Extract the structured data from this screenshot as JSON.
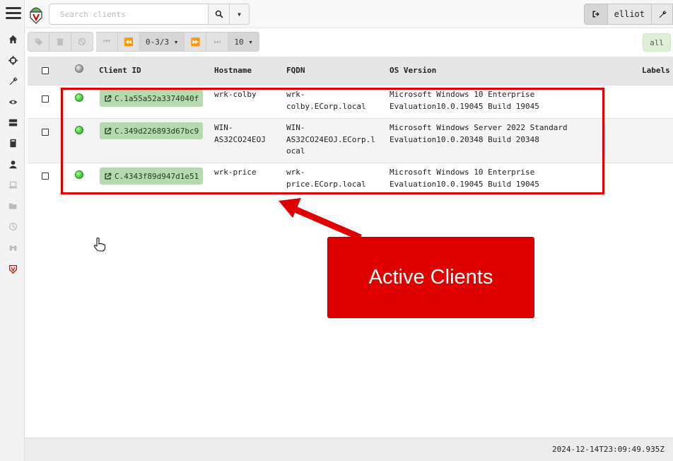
{
  "topbar": {
    "search_placeholder": "Search clients",
    "user": "elliot"
  },
  "toolbar": {
    "pager": "0-3/3",
    "page_size": "10",
    "filter": "all"
  },
  "table": {
    "columns": [
      "Client ID",
      "Hostname",
      "FQDN",
      "OS Version",
      "Labels"
    ],
    "rows": [
      {
        "client_id": "C.1a55a52a3374040f",
        "hostname": [
          "wrk-colby"
        ],
        "fqdn": [
          "wrk-",
          "colby.ECorp.local"
        ],
        "os": [
          "Microsoft Windows 10 Enterprise",
          "Evaluation10.0.19045 Build 19045"
        ],
        "status": "online"
      },
      {
        "client_id": "C.349d226893d67bc9",
        "hostname": [
          "WIN-",
          "AS32CO24EOJ"
        ],
        "fqdn": [
          "WIN-",
          "AS32CO24EOJ.ECorp.l",
          "ocal"
        ],
        "os": [
          "Microsoft Windows Server 2022 Standard",
          "Evaluation10.0.20348 Build 20348"
        ],
        "status": "online"
      },
      {
        "client_id": "C.4343f89d947d1e51",
        "hostname": [
          "wrk-price"
        ],
        "fqdn": [
          "wrk-",
          "price.ECorp.local"
        ],
        "os": [
          "Microsoft Windows 10 Enterprise",
          "Evaluation10.0.19045 Build 19045"
        ],
        "status": "online"
      }
    ]
  },
  "annotation": {
    "callout_text": "Active Clients",
    "color": "#e00000"
  },
  "footer": {
    "timestamp": "2024-12-14T23:09:49.935Z"
  },
  "colors": {
    "online": "#3ecb2e",
    "badge": "#b6d9b0",
    "filter": "#dff0d8"
  }
}
